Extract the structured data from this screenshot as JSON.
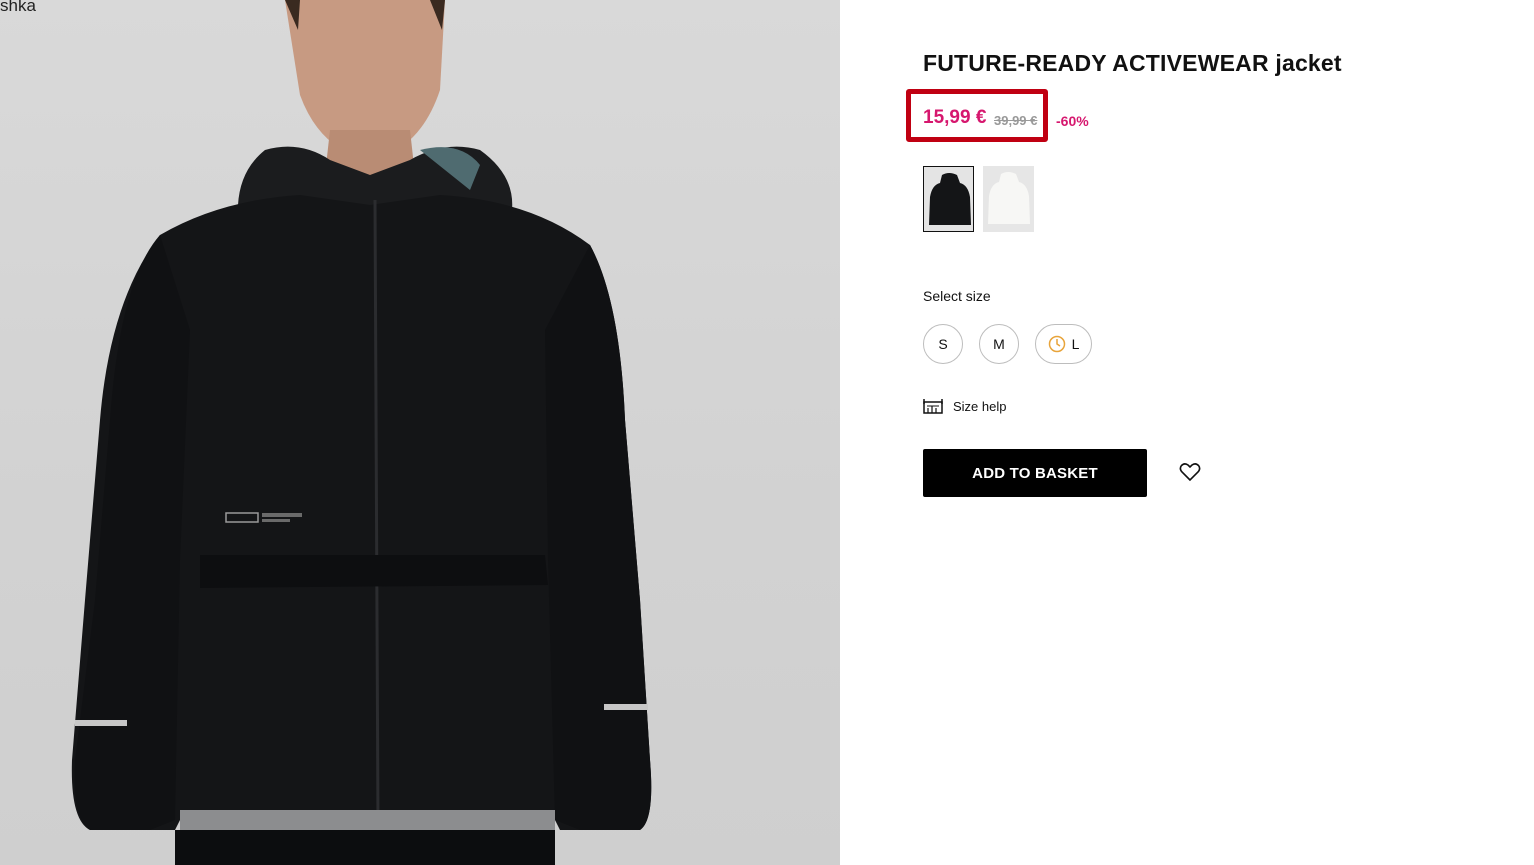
{
  "page": {
    "corner_text": "shka"
  },
  "product": {
    "title": "FUTURE-READY ACTIVEWEAR jacket",
    "price_current": "15,99 €",
    "price_old": "39,99 €",
    "discount": "-60%",
    "colors": {
      "sale": "#d6176e",
      "highlight": "#c00012",
      "button_bg": "#000000"
    },
    "swatches": [
      {
        "name": "black",
        "selected": true
      },
      {
        "name": "white",
        "selected": false
      }
    ]
  },
  "size": {
    "label": "Select size",
    "options": [
      {
        "label": "S"
      },
      {
        "label": "M"
      },
      {
        "label": "L",
        "icon": "clock-icon"
      }
    ],
    "help_label": "Size help",
    "help_icon": "ruler-icon"
  },
  "actions": {
    "add_to_basket": "ADD TO BASKET",
    "wishlist_icon": "heart-icon"
  }
}
